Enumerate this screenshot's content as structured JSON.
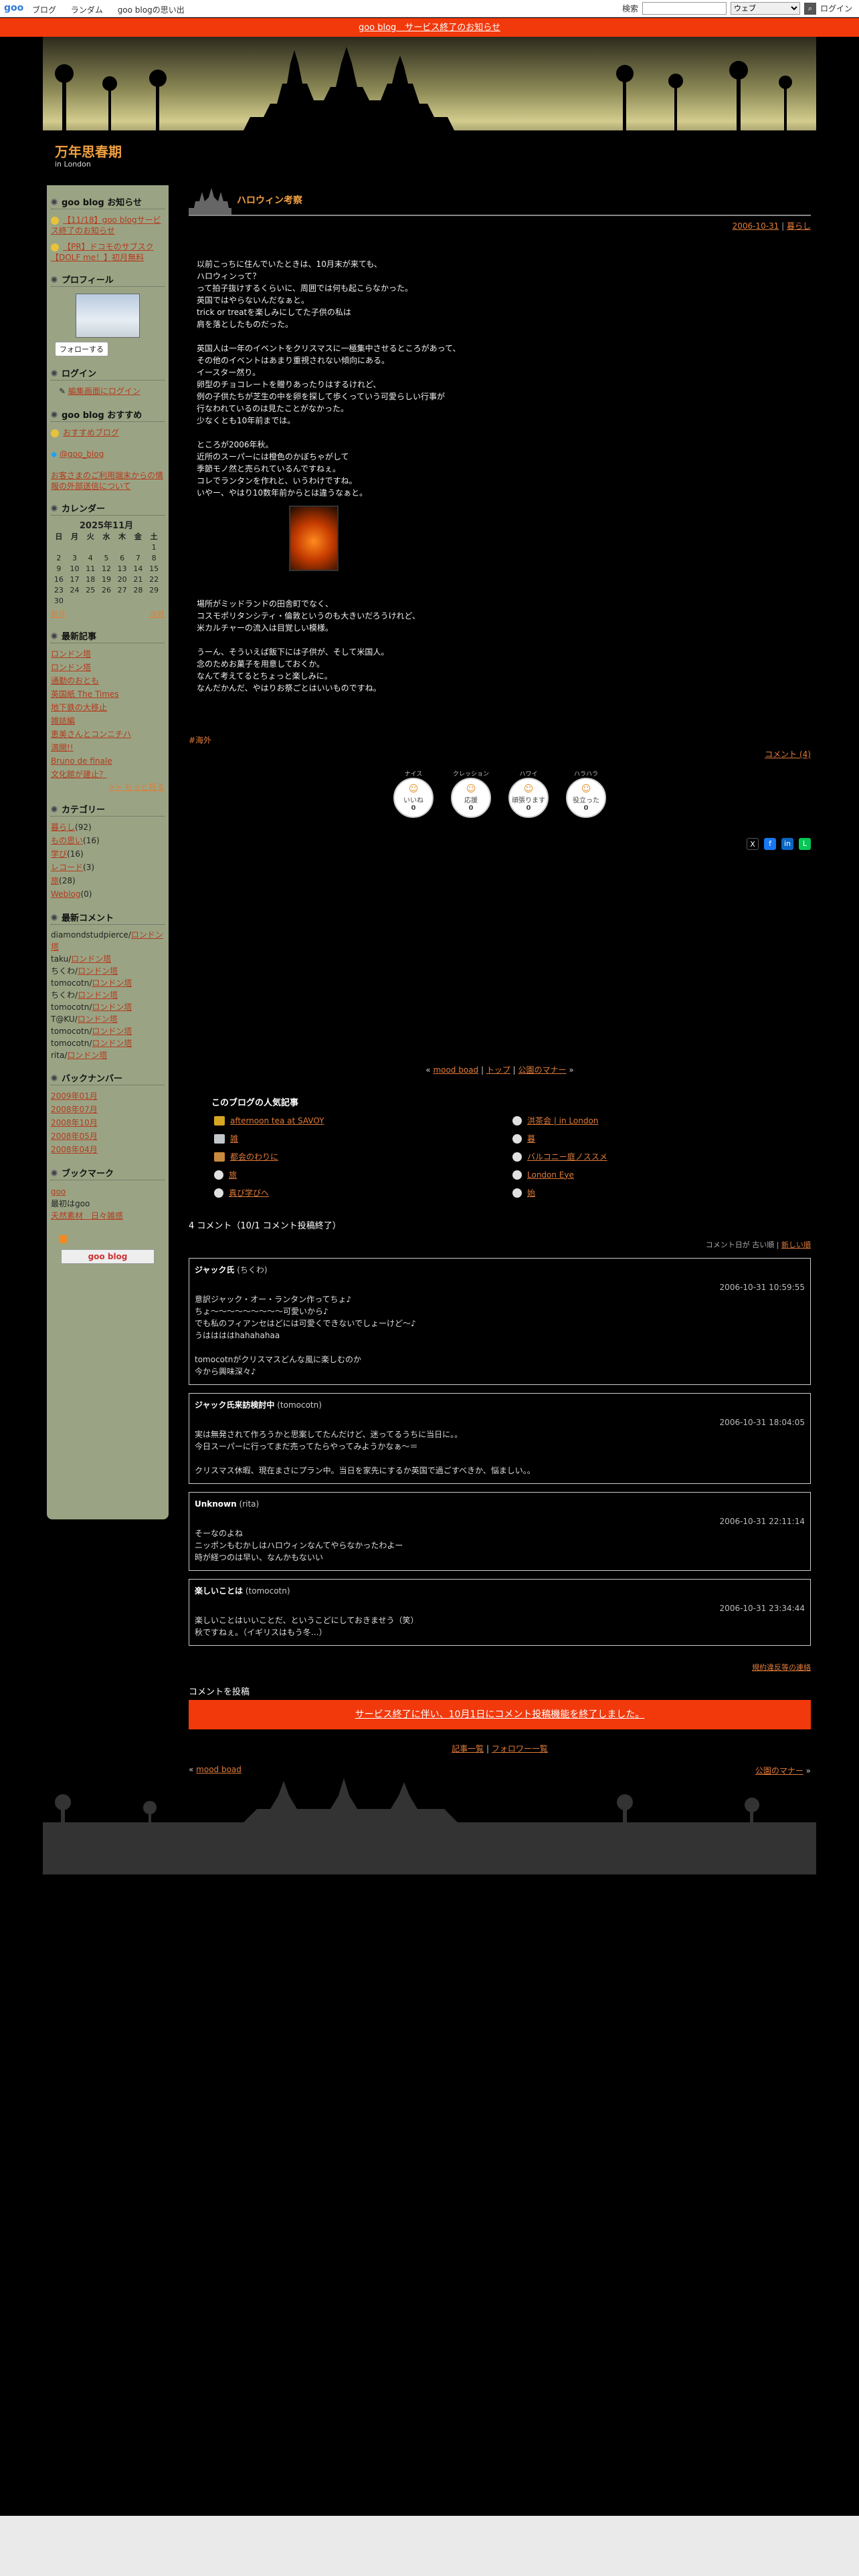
{
  "topbar": {
    "logo": "goo",
    "nav": [
      "ブログ",
      "ランダム",
      "goo blogの思い出"
    ],
    "search_label": "検索",
    "search_scope": "ウェブ",
    "login": "ログイン"
  },
  "notice": "goo blog　サービス終了のお知らせ",
  "blog": {
    "title": "万年思春期",
    "subtitle": "in London"
  },
  "sidebar": {
    "news_head": "goo blog お知らせ",
    "news": [
      "【11/18】goo blogサービス終了のお知らせ",
      "【PR】ドコモのサブスク【DOLF me！】初月無料"
    ],
    "profile_head": "プロフィール",
    "follow": "フォローする",
    "login_head": "ログイン",
    "login_link": "編集画面にログイン",
    "recommend_head": "goo blog おすすめ",
    "recommend_link": "おすすめブログ",
    "twitter": "@goo_blog",
    "info_link": "お客さまのご利用端末からの情報の外部送信について",
    "calendar_head": "カレンダー",
    "calendar_caption": "2025年11月",
    "calendar_days": [
      "日",
      "月",
      "火",
      "水",
      "木",
      "金",
      "土"
    ],
    "calendar_rows": [
      [
        "",
        "",
        "",
        "",
        "",
        "",
        "1"
      ],
      [
        "2",
        "3",
        "4",
        "5",
        "6",
        "7",
        "8"
      ],
      [
        "9",
        "10",
        "11",
        "12",
        "13",
        "14",
        "15"
      ],
      [
        "16",
        "17",
        "18",
        "19",
        "20",
        "21",
        "22"
      ],
      [
        "23",
        "24",
        "25",
        "26",
        "27",
        "28",
        "29"
      ],
      [
        "30",
        "",
        "",
        "",
        "",
        "",
        ""
      ]
    ],
    "cal_prev": "前月",
    "cal_next": "次月",
    "recent_head": "最新記事",
    "recent": [
      "ロンドン塔",
      "ロンドン塔",
      "通勤のおとも",
      "英国紙 The Times",
      "地下鉄の大移止",
      "雑誌編",
      "恵美さんとコンニチハ",
      "満開!!",
      "Bruno de finale",
      "文化館が建止？"
    ],
    "recent_more": ">> もっと見る",
    "category_head": "カテゴリー",
    "categories": [
      {
        "name": "暮らし",
        "count": "(92)"
      },
      {
        "name": "もの思い",
        "count": "(16)"
      },
      {
        "name": "学び",
        "count": "(16)"
      },
      {
        "name": "レコード",
        "count": "(3)"
      },
      {
        "name": "旅",
        "count": "(28)"
      },
      {
        "name": "Weblog",
        "count": "(0)"
      }
    ],
    "comments_head": "最新コメント",
    "comments": [
      {
        "who": "diamondstudpierce",
        "on": "ロンドン塔"
      },
      {
        "who": "taku",
        "on": "ロンドン塔"
      },
      {
        "who": "ちくわ",
        "on": "ロンドン塔"
      },
      {
        "who": "tomocotn",
        "on": "ロンドン塔"
      },
      {
        "who": "ちくわ",
        "on": "ロンドン塔"
      },
      {
        "who": "tomocotn",
        "on": "ロンドン塔"
      },
      {
        "who": "T@KU",
        "on": "ロンドン塔"
      },
      {
        "who": "tomocotn",
        "on": "ロンドン塔"
      },
      {
        "who": "tomocotn",
        "on": "ロンドン塔"
      },
      {
        "who": "rita",
        "on": "ロンドン塔"
      }
    ],
    "backnumber_head": "バックナンバー",
    "backnumbers": [
      "2009年01月",
      "2008年07月",
      "2008年10月",
      "2008年05月",
      "2008年04月"
    ],
    "bookmark_head": "ブックマーク",
    "bookmarks": [
      "goo",
      "最初はgoo",
      "天然素材　日々雑感"
    ],
    "goo_logo": "goo blog"
  },
  "entry": {
    "title": "ハロウィン考察",
    "date": "2006-10-31",
    "category": "暮らし",
    "body1": "以前こっちに住んでいたときは、10月末が来ても、\nハロウィンって？\nって拍子抜けするくらいに、周囲では何も起こらなかった。\n英国ではやらないんだなぁと。\ntrick or treatを楽しみにしてた子供の私は\n肩を落としたものだった。\n\n英国人は一年のイベントをクリスマスに一極集中させるところがあって、\nその他のイベントはあまり重視されない傾向にある。\nイースター然り。\n卵型のチョコレートを贈りあったりはするけれど、\n例の子供たちが芝生の中を卵を探して歩くっていう可愛らしい行事が\n行なわれているのは見たことがなかった。\n少なくとも10年前までは。\n\nところが2006年秋。\n近所のスーパーには橙色のかぼちゃがして\n季節モノ然と売られているんですねぇ。\nコレでランタンを作れと、いうわけですね。\nいやー、やはり10数年前からとは違うなぁと。",
    "body2": "場所がミッドランドの田舎町でなく、\nコスモポリタンシティ・倫敦というのも大きいだろうけれど、\n米カルチャーの流入は目覚しい模様。\n\nうーん、そういえば飯下には子供が、そして米国人。\n念のためお菓子を用意しておくか。\nなんて考えてるとちょっと楽しみに。\nなんだかんだ、やはりお祭ごとはいいものですね。",
    "tag": "#海外",
    "comment_link": "コメント (4)",
    "reactions": [
      {
        "label": "ナイス",
        "name": "いいね",
        "count": "0"
      },
      {
        "label": "クレッション",
        "name": "応援",
        "count": "0"
      },
      {
        "label": "ハワイ",
        "name": "頑張ります",
        "count": "0"
      },
      {
        "label": "ハラハラ",
        "name": "役立った",
        "count": "0"
      }
    ]
  },
  "pager": {
    "prev": "mood boad",
    "top": "トップ",
    "next": "公園のマナー"
  },
  "popular": {
    "head": "このブログの人気記事",
    "items": [
      "afternoon tea at SAVOY",
      "雑",
      "都会のわりに",
      "旅",
      "真び学びへ",
      "洪茶会 | in London",
      "暮",
      "バルコニー庭ノススメ",
      "London Eye",
      "始"
    ]
  },
  "comments": {
    "head": "4 コメント（10/1 コメント投稿終了）",
    "sort_label": "コメント日が",
    "sort_old": "古い順",
    "sort_new": "新しい順",
    "items": [
      {
        "name": "ジャック氏",
        "handle": "ちくわ",
        "date": "2006-10-31 10:59:55",
        "text": "意訳ジャック・オー・ランタン作ってちょ♪\nちょ〜〜〜〜〜〜〜〜〜可愛いから♪\nでも私のフィアンセはどには可愛くできないでしょーけど〜♪\nうははははhahahahaa\n\ntomocotnがクリスマスどんな風に楽しむのか\n今から興味深々♪"
      },
      {
        "name": "ジャック氏来訪検討中",
        "handle": "tomocotn",
        "date": "2006-10-31 18:04:05",
        "text": "実は無発されて作ろうかと思案してたんだけど、迷ってるうちに当日に。。\n今日スーパーに行ってまだ売ってたらやってみようかなぁ〜＝\n\nクリスマス休暇、現在まさにプラン中。当日を家先にするか英国で過ごすべきか、悩ましい。。"
      },
      {
        "name": "Unknown",
        "handle": "rita",
        "date": "2006-10-31 22:11:14",
        "text": "そーなのよね\nニッポンもむかしはハロウィンなんてやらなかったわよー\n時が経つのは早い、なんかもないい"
      },
      {
        "name": "楽しいことは",
        "handle": "tomocotn",
        "date": "2006-10-31 23:34:44",
        "text": "楽しいことはいいことだ、というこどにしておきませう（笑）\n秋ですねぇ。（イギリスはもう冬…）"
      }
    ]
  },
  "policy": "規約違反等の連絡",
  "post": {
    "head": "コメントを投稿",
    "closed": "サービス終了に伴い、10月1日にコメント投稿機能を終了しました。"
  },
  "foot_links": {
    "list": "記事一覧",
    "follower": "フォロワー一覧"
  }
}
